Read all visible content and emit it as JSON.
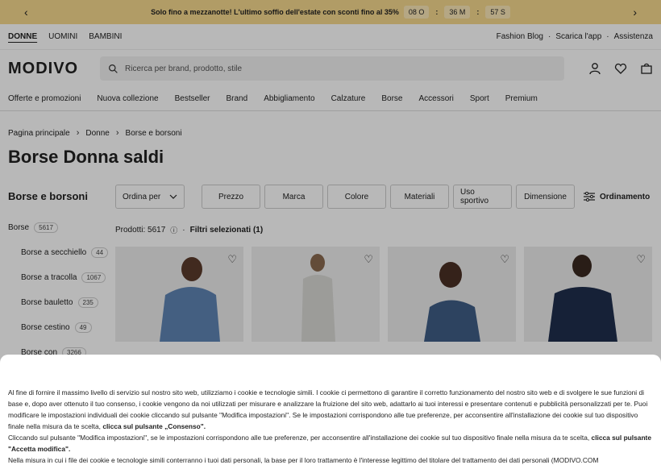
{
  "promo": {
    "text": "Solo fino a mezzanotte! L'ultimo soffio dell'estate con sconti fino al 35%",
    "hours": "08 O",
    "minutes": "36 M",
    "seconds": "57 S",
    "sep": ":"
  },
  "topnav": {
    "genders": [
      "DONNE",
      "UOMINI",
      "BAMBINI"
    ],
    "links": [
      "Fashion Blog",
      "·",
      "Scarica l'app",
      "·",
      "Assistenza"
    ]
  },
  "header": {
    "logo": "MODIVO",
    "search_placeholder": "Ricerca per brand, prodotto, stile"
  },
  "catnav": [
    "Offerte e promozioni",
    "Nuova collezione",
    "Bestseller",
    "Brand",
    "Abbigliamento",
    "Calzature",
    "Borse",
    "Accessori",
    "Sport",
    "Premium"
  ],
  "breadcrumb": [
    "Pagina principale",
    "Donne",
    "Borse e borsoni"
  ],
  "page_title": "Borse Donna saldi",
  "sidebar": {
    "heading": "Borse e borsoni",
    "items": [
      {
        "label": "Borse",
        "count": "5617",
        "sub": false
      },
      {
        "label": "Borse a secchiello",
        "count": "44",
        "sub": true
      },
      {
        "label": "Borse a tracolla",
        "count": "1067",
        "sub": true
      },
      {
        "label": "Borse bauletto",
        "count": "235",
        "sub": true
      },
      {
        "label": "Borse cestino",
        "count": "49",
        "sub": true
      },
      {
        "label": "Borse con",
        "count": "3266",
        "sub": true
      }
    ]
  },
  "filters": {
    "sort_label": "Ordina per",
    "buttons": [
      "Prezzo",
      "Marca",
      "Colore",
      "Materiali",
      "Uso sportivo",
      "Dimensione"
    ],
    "ordinamento": "Ordinamento"
  },
  "products": {
    "count_text": "Prodotti: 5617",
    "dot": "·",
    "selected_filters": "Filtri selezionati (1)"
  },
  "cookie": {
    "p1": "Al fine di fornire il massimo livello di servizio sul nostro sito web, utilizziamo i cookie e tecnologie simili. I cookie ci permettono di garantire il corretto funzionamento del nostro sito web e di svolgere le sue funzioni di base e, dopo aver ottenuto il tuo consenso, i cookie vengono da noi utilizzati per misurare e analizzare la fruizione del sito web, adattarlo ai tuoi interessi e presentare contenuti e pubblicità personalizzati per te. Puoi modificare le impostazioni individuali dei cookie cliccando sul pulsante \"Modifica impostazioni\". Se le impostazioni corrispondono alle tue preferenze, per acconsentire all'installazione dei cookie sul tuo dispositivo finale nella misura da te scelta, ",
    "p1_bold": "clicca sul pulsante „Consenso\".",
    "p2": "Cliccando sul pulsante \"Modifica impostazioni\", se le impostazioni corrispondono alle tue preferenze, per acconsentire all'installazione dei cookie sul tuo dispositivo finale nella misura da te scelta, ",
    "p2_bold": "clicca sul pulsante \"Accetta modifica\".",
    "p3": "Nella misura in cui i file dei cookie e tecnologie simili conterranno i tuoi dati personali, la base per il loro trattamento è l'interesse legittimo del titolare del trattamento dei dati personali (MODIVO.COM"
  },
  "colors": {
    "promo_bg": "#f6d98e",
    "overlay": "rgba(0,0,0,0.28)"
  }
}
